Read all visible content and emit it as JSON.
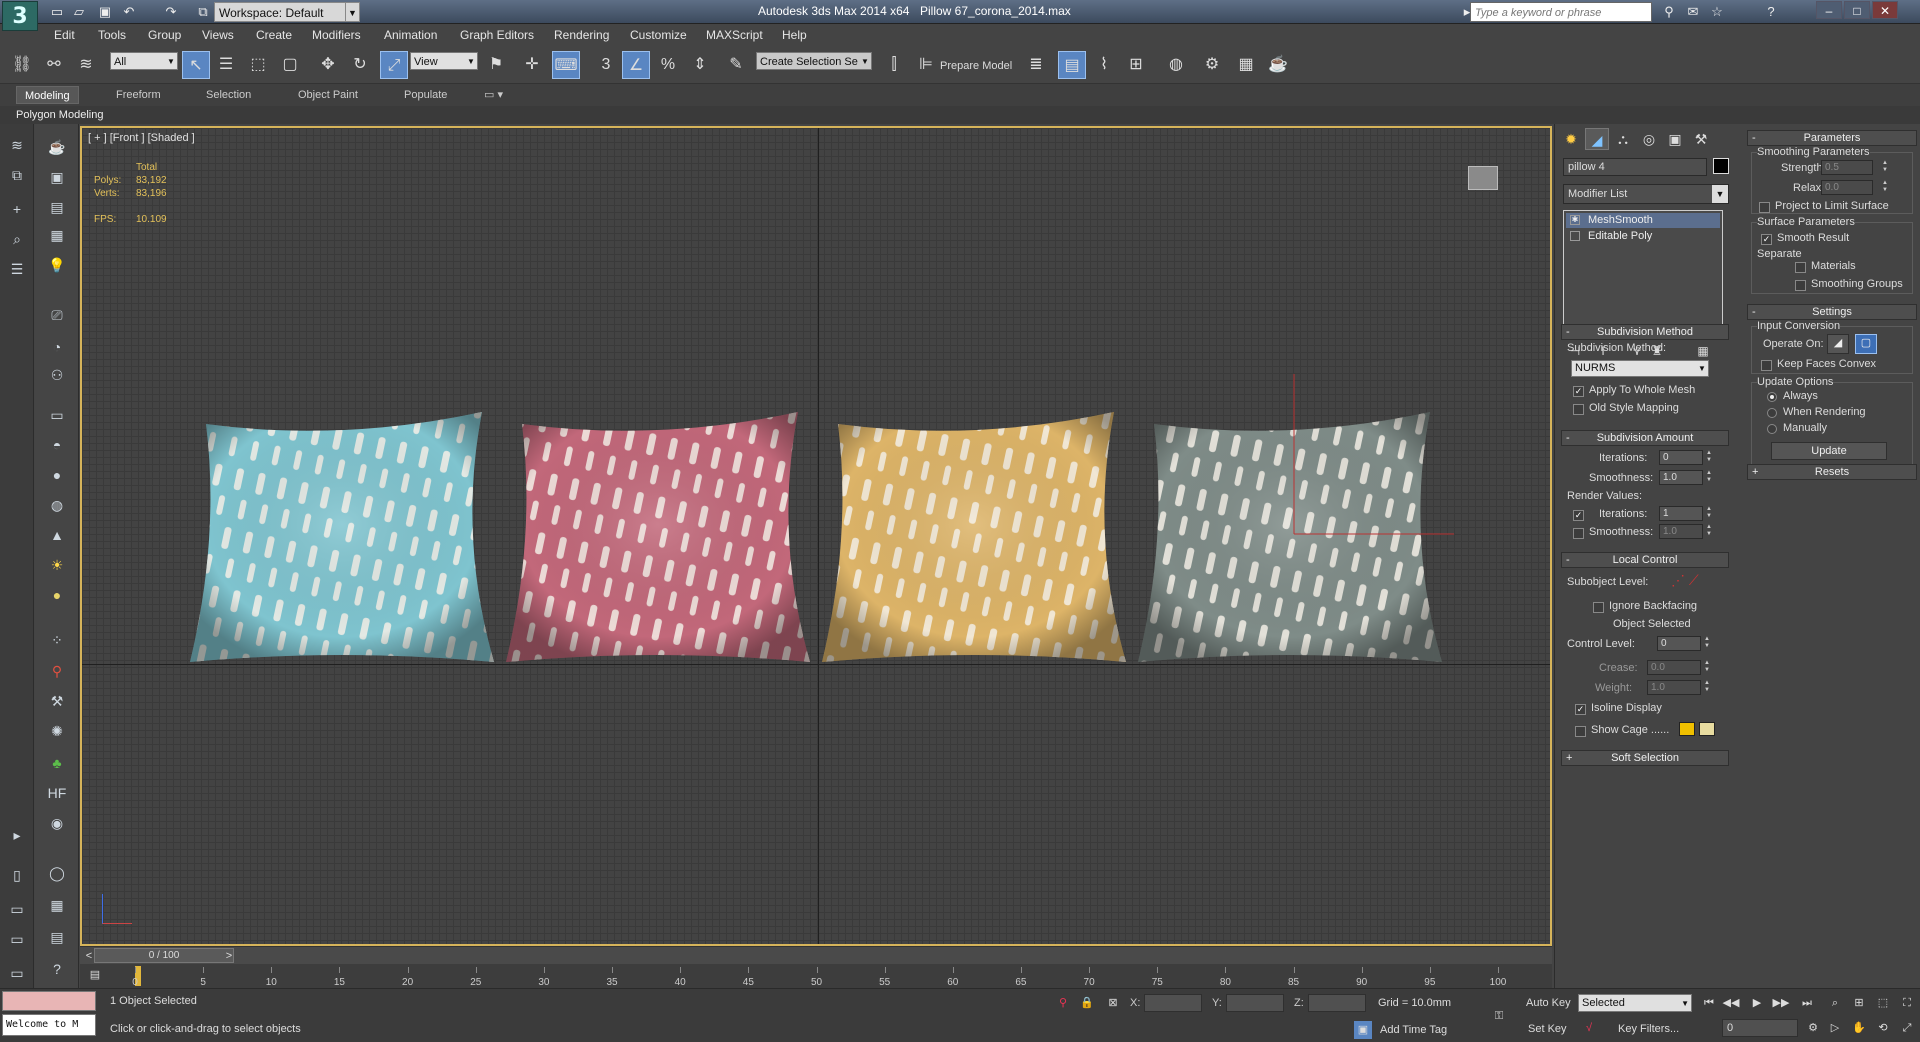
{
  "app": {
    "title": "Autodesk 3ds Max  2014 x64",
    "file": "Pillow 67_corona_2014.max",
    "workspace": "Workspace: Default",
    "search_placeholder": "Type a keyword or phrase"
  },
  "menu": [
    "Edit",
    "Tools",
    "Group",
    "Views",
    "Create",
    "Modifiers",
    "Animation",
    "Graph Editors",
    "Rendering",
    "Customize",
    "MAXScript",
    "Help"
  ],
  "toolbar": {
    "selection_filter": "All",
    "ref_coord": "View",
    "named_selection": "Create Selection Se",
    "prepare_model": "Prepare Model"
  },
  "ribbon": {
    "tabs": [
      "Modeling",
      "Freeform",
      "Selection",
      "Object Paint",
      "Populate"
    ],
    "active_tab": "Modeling",
    "panel": "Polygon Modeling"
  },
  "viewport": {
    "label": "[ + ] [Front ] [Shaded ]",
    "stats": {
      "total_header": "Total",
      "polys_label": "Polys:",
      "polys": "83,192",
      "verts_label": "Verts:",
      "verts": "83,196",
      "fps_label": "FPS:",
      "fps": "10.109"
    },
    "pillows": [
      {
        "color": "#7fc4cf",
        "accent": "#eae4dc"
      },
      {
        "color": "#c2687a",
        "accent": "#eadcd8"
      },
      {
        "color": "#ddb468",
        "accent": "#f1e6d0"
      },
      {
        "color": "#7f8c88",
        "accent": "#e2ddd3"
      }
    ]
  },
  "timeline": {
    "position": "0 / 100",
    "ticks": [
      "0",
      "5",
      "10",
      "15",
      "20",
      "25",
      "30",
      "35",
      "40",
      "45",
      "50",
      "55",
      "60",
      "65",
      "70",
      "75",
      "80",
      "85",
      "90",
      "95",
      "100"
    ]
  },
  "status": {
    "selection": "1 Object Selected",
    "prompt": "Click or click-and-drag to select objects",
    "welcome": "Welcome to M",
    "x_label": "X:",
    "y_label": "Y:",
    "z_label": "Z:",
    "grid": "Grid = 10.0mm",
    "add_time_tag": "Add Time Tag",
    "auto_key": "Auto Key",
    "set_key": "Set Key",
    "key_mode": "Selected",
    "key_filters": "Key Filters...",
    "frame": "0"
  },
  "command_panel": {
    "object_name": "pillow 4",
    "modifier_list": "Modifier List",
    "stack": [
      "MeshSmooth",
      "Editable Poly"
    ],
    "subdivision_method": {
      "title": "Subdivision Method",
      "label": "Subdivision Method:",
      "value": "NURMS",
      "apply_to_whole_mesh": "Apply To Whole Mesh",
      "old_style_mapping": "Old Style Mapping"
    },
    "subdivision_amount": {
      "title": "Subdivision Amount",
      "iterations_label": "Iterations:",
      "iterations": "0",
      "smoothness_label": "Smoothness:",
      "smoothness": "1.0",
      "render_values": "Render Values:",
      "render_iterations": "1",
      "render_smoothness": "1.0"
    },
    "local_control": {
      "title": "Local Control",
      "subobject_level": "Subobject Level:",
      "ignore_backfacing": "Ignore Backfacing",
      "object_selected": "Object Selected",
      "control_level_label": "Control Level:",
      "control_level": "0",
      "crease_label": "Crease:",
      "crease": "0.0",
      "weight_label": "Weight:",
      "weight": "1.0",
      "isoline_display": "Isoline Display",
      "show_cage": "Show Cage ......",
      "cage_color_1": "#f0c000",
      "cage_color_2": "#e8dca0"
    },
    "soft_selection": "Soft Selection",
    "parameters": {
      "title": "Parameters",
      "smoothing_parameters": "Smoothing Parameters",
      "strength_label": "Strength:",
      "strength": "0.5",
      "relax_label": "Relax:",
      "relax": "0.0",
      "project_to_limit": "Project to Limit Surface",
      "surface_parameters": "Surface Parameters",
      "smooth_result": "Smooth Result",
      "separate": "Separate",
      "materials": "Materials",
      "smoothing_groups": "Smoothing Groups"
    },
    "settings": {
      "title": "Settings",
      "input_conversion": "Input Conversion",
      "operate_on": "Operate On:",
      "keep_faces_convex": "Keep Faces Convex",
      "update_options": "Update Options",
      "always": "Always",
      "when_rendering": "When Rendering",
      "manually": "Manually",
      "update": "Update"
    },
    "resets": "Resets"
  }
}
